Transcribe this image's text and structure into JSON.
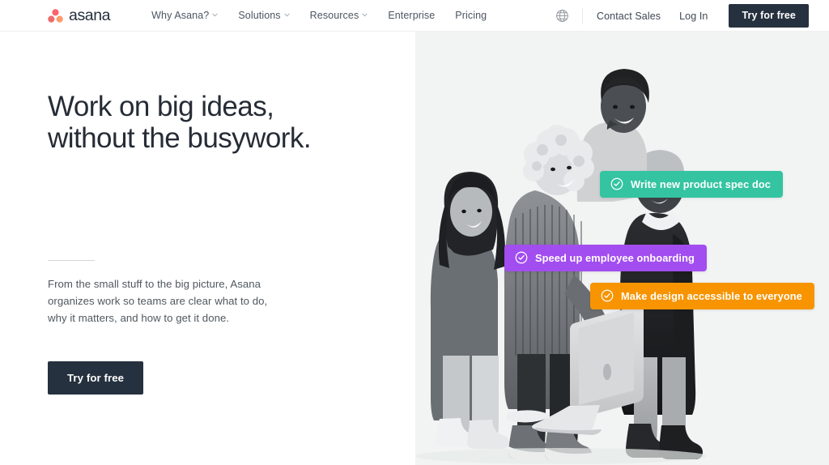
{
  "brand": {
    "logo_icon": "asana-dots-logo",
    "name": "asana",
    "dot_color": "#f06a6a",
    "dot_color_2": "#fc636b",
    "dot_color_3": "#ff9a6c",
    "wordmark_color": "#24303e"
  },
  "navbar": {
    "links": [
      {
        "label": "Why Asana?",
        "icon": "chevron-down-icon",
        "has_menu": true
      },
      {
        "label": "Solutions",
        "icon": "chevron-down-icon",
        "has_menu": true
      },
      {
        "label": "Resources",
        "icon": "chevron-down-icon",
        "has_menu": true
      },
      {
        "label": "Enterprise",
        "has_menu": false
      },
      {
        "label": "Pricing",
        "has_menu": false
      }
    ],
    "language_icon": "globe-icon",
    "contact_sales_label": "Contact Sales",
    "login_label": "Log In",
    "try_for_free_label": "Try for free",
    "cta_color": "#26313f"
  },
  "hero": {
    "headline_line_1": "Work on big ideas,",
    "headline_line_2": "without the busywork.",
    "paragraph": "From the small stuff to the big picture, Asana organizes work so teams are clear what to do, why it matters, and how to get it done.",
    "cta_label": "Try for free",
    "cta_color": "#26313f",
    "panel_bg": "#f1f4f3",
    "image_alt": "Four colleagues in black-and-white photo smiling around an open laptop",
    "chips": [
      {
        "label": "Write new product spec doc",
        "color": "#34c4a1",
        "icon": "check-circle-icon"
      },
      {
        "label": "Speed up employee onboarding",
        "color": "#a24df0",
        "icon": "check-circle-icon"
      },
      {
        "label": "Make design accessible to everyone",
        "color": "#f79400",
        "icon": "check-circle-icon"
      }
    ]
  }
}
